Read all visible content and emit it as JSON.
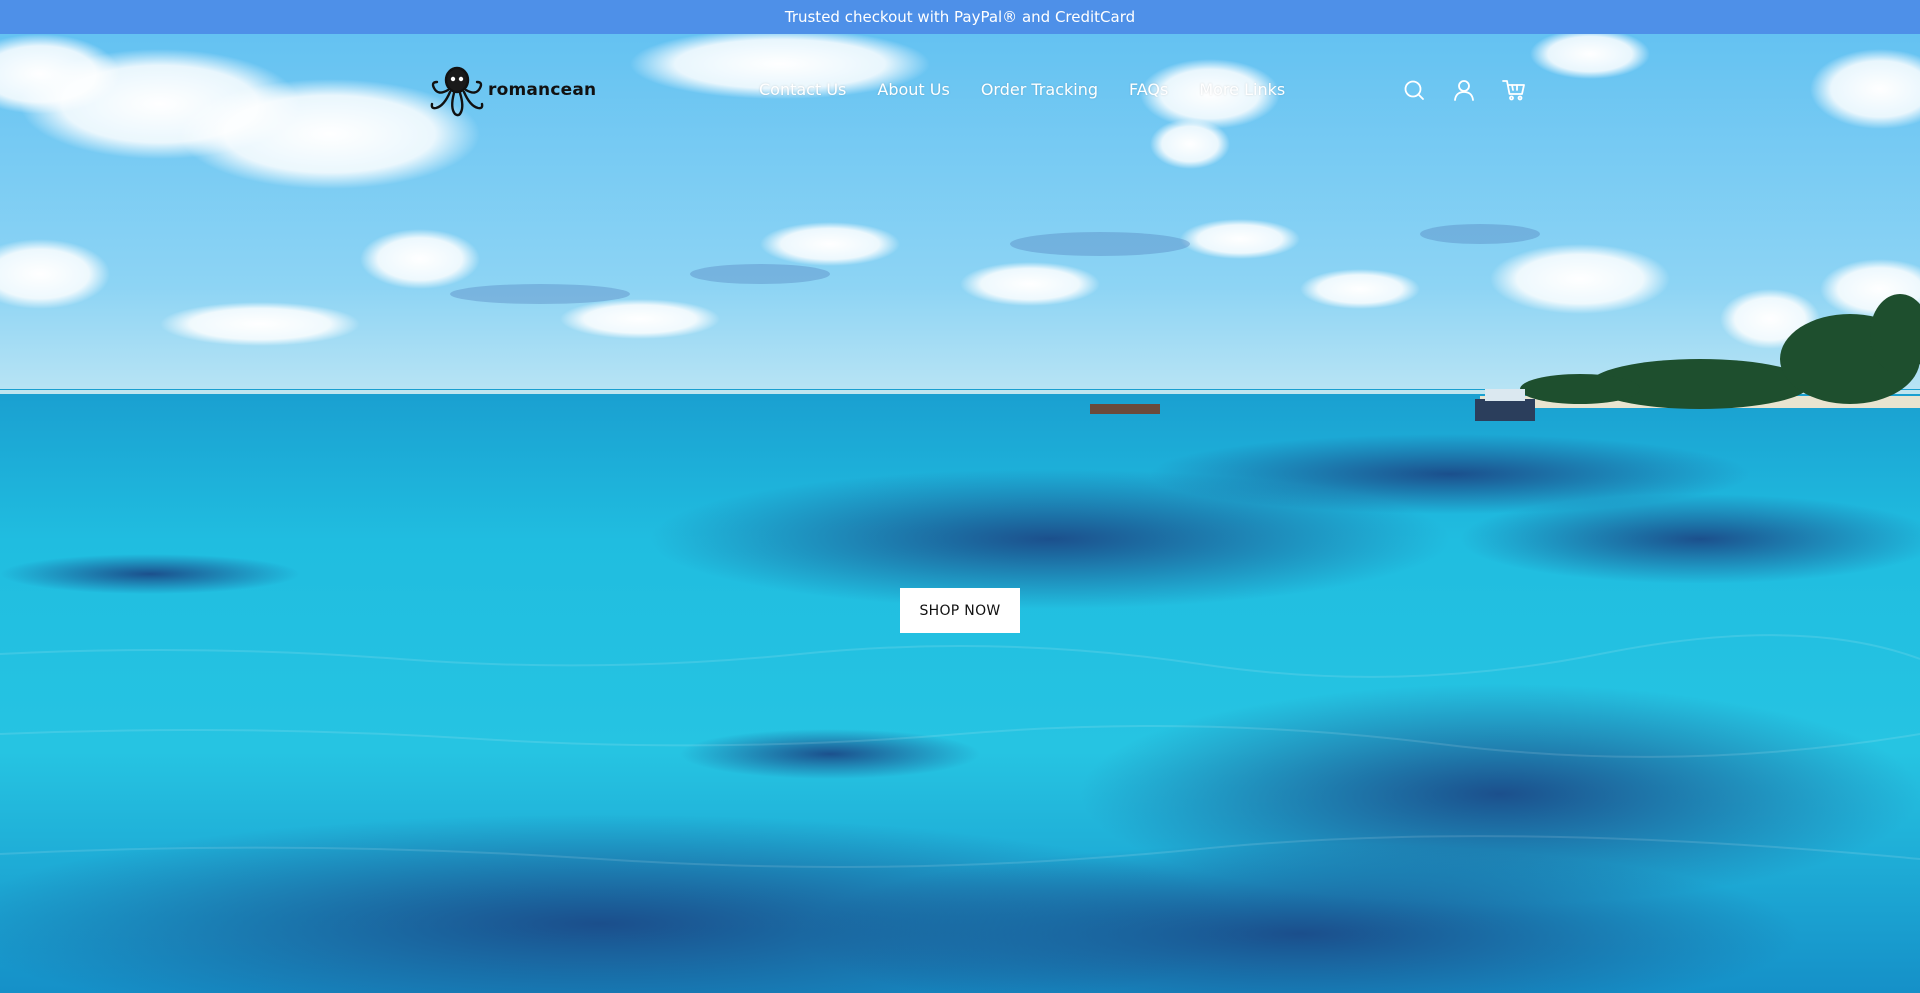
{
  "announcement": {
    "text": "Trusted checkout with PayPal® and CreditCard"
  },
  "brand": {
    "name": "romancean",
    "logo_icon": "octopus-icon"
  },
  "nav": {
    "items": [
      {
        "label": "Contact Us"
      },
      {
        "label": "About Us"
      },
      {
        "label": "Order Tracking"
      },
      {
        "label": "FAQs"
      },
      {
        "label": "More Links"
      }
    ]
  },
  "header_icons": [
    "search-icon",
    "account-icon",
    "cart-icon"
  ],
  "hero": {
    "cta_label": "SHOP NOW"
  },
  "colors": {
    "announcement_bg": "#4e90e8",
    "sky_top": "#6cc6f2",
    "sea": "#22b8dc",
    "deep_water": "#1b4f8a"
  }
}
